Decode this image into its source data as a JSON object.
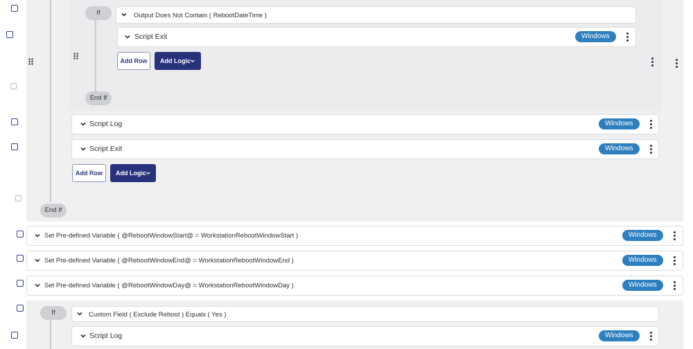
{
  "badge": "Windows",
  "inner_if": {
    "if_label": "If",
    "condition": "Output Does Not Contain ( RebootDateTime )",
    "exit_label": "Script Exit",
    "add_row": "Add Row",
    "add_logic": "Add Logic",
    "end_if": "End If"
  },
  "outer_if": {
    "rows": [
      "Script Log",
      "Script Exit"
    ],
    "add_row": "Add Row",
    "add_logic": "Add Logic",
    "end_if": "End If"
  },
  "variables": [
    "Set Pre-defined Variable ( @RebootWindowStart@ = WorkstationRebootWindowStart )",
    "Set Pre-defined Variable ( @RebootWindowEnd@ = WorkstationRebootWindowEnd )",
    "Set Pre-defined Variable ( @RebootWindowDay@ = WorkstationRebootWindowDay )"
  ],
  "custom_if": {
    "if_label": "If",
    "condition": "Custom Field ( Exclude Reboot ) Equals ( Yes )",
    "log_label": "Script Log"
  },
  "colors": {
    "badge": "#2d7fbf",
    "primary_button": "#27327a",
    "block_background": "#f0f0f1"
  }
}
